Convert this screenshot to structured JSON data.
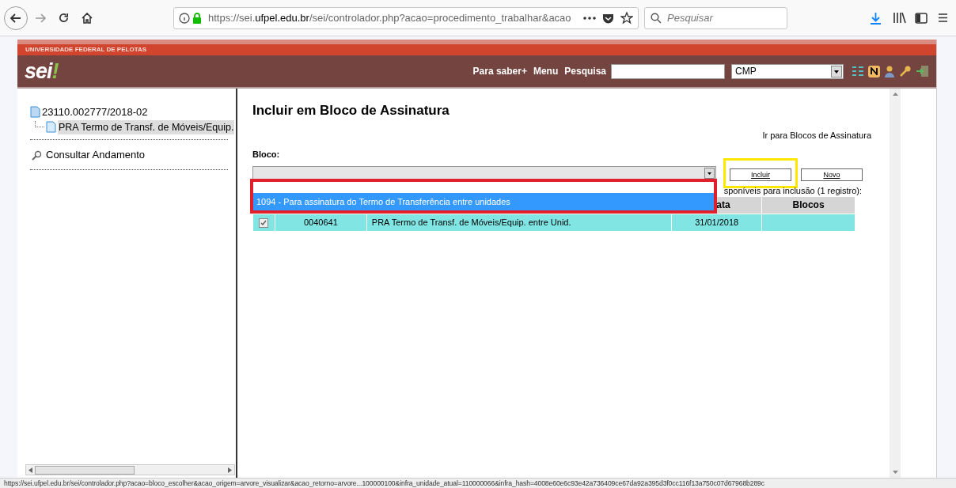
{
  "browser": {
    "url_prefix": "https://sei.",
    "url_domain": "ufpel.edu.br",
    "url_rest": "/sei/controlador.php?acao=procedimento_trabalhar&acao",
    "search_placeholder": "Pesquisar"
  },
  "header": {
    "institution": "UNIVERSIDADE FEDERAL DE PELOTAS",
    "logo": "sei",
    "logo_mark": "!",
    "links": [
      "Para saber+",
      "Menu",
      "Pesquisa"
    ],
    "unit": "CMP"
  },
  "tree": {
    "process": "23110.002777/2018-02",
    "children": [
      {
        "label": "PRA Termo de Transf. de Móveis/Equip.",
        "selected": true
      }
    ],
    "consult": "Consultar Andamento"
  },
  "main": {
    "title": "Incluir em Bloco de Assinatura",
    "link": "Ir para Blocos de Assinatura",
    "field_label": "Bloco:",
    "buttons": [
      {
        "label": "Incluir",
        "highlighted": true
      },
      {
        "label": "Novo",
        "highlighted": false
      }
    ],
    "dropdown": {
      "options": [
        {
          "label": "1094 - Para assinatura do Termo de Transferência entre unidades",
          "selected": true
        }
      ]
    },
    "caption": "sponíveis para inclusão (1 registro):",
    "columns": [
      "",
      "",
      "",
      "ata",
      "Blocos"
    ],
    "rows": [
      {
        "checked": true,
        "cells": [
          "0040641",
          "PRA Termo de Transf. de Móveis/Equip. entre Unid.",
          "31/01/2018",
          ""
        ]
      }
    ]
  },
  "status_bar": "https://sei.ufpel.edu.br/sei/controlador.php?acao=bloco_escolher&acao_origem=arvore_visualizar&acao_retorno=arvore...100000100&infra_unidade_atual=110000066&infra_hash=4008e60e6c93e42a736409ce67da92a395d3f0cc116f13a750c07d67968b289c"
}
